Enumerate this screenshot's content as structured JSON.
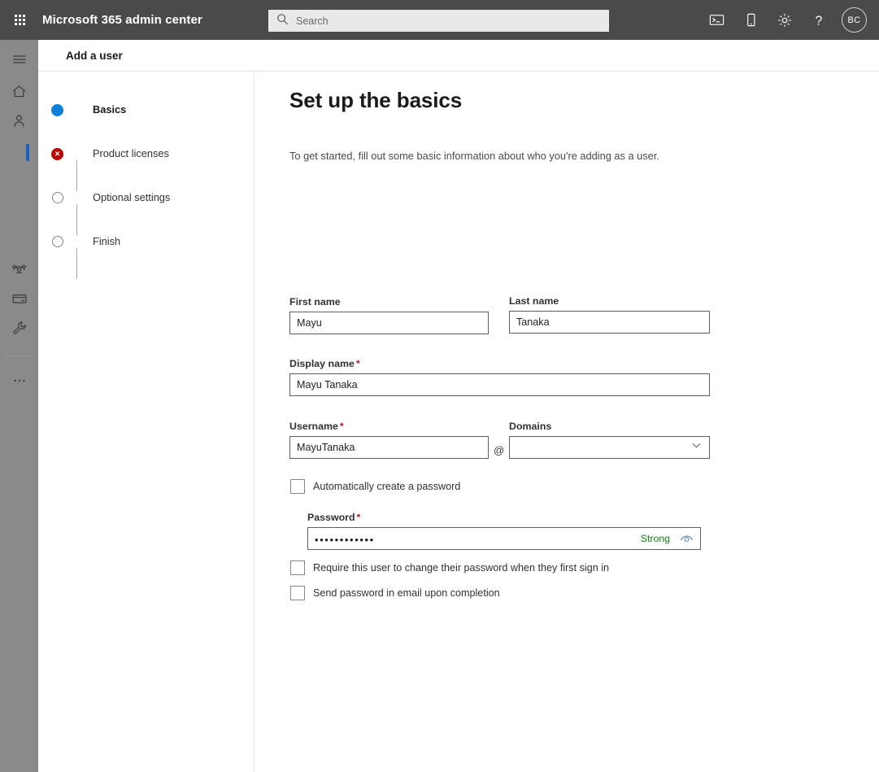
{
  "suitebar": {
    "waffle_label": "App launcher",
    "title": "Microsoft 365 admin center",
    "search_placeholder": "Search",
    "search_value": "",
    "icons": [
      {
        "name": "cloud-shell-icon",
        "label": "Cloud Shell"
      },
      {
        "name": "mobile-device-icon",
        "label": "Mobile"
      },
      {
        "name": "gear-icon",
        "label": "Settings"
      },
      {
        "name": "help-icon",
        "label": "Help"
      }
    ],
    "avatar_initials": "BC",
    "background_color": "#4a4a4a"
  },
  "rail": {
    "background_color": "#898989",
    "selected_indicator_color": "#1b5fbe",
    "items": [
      {
        "name": "hamburger-menu-icon",
        "label": "Show navigation",
        "selected": false
      },
      {
        "name": "home-icon",
        "label": "Home",
        "selected": false
      },
      {
        "name": "users-person-icon",
        "label": "Users",
        "selected": true
      },
      {
        "name": "teams-groups-icon",
        "label": "Teams & groups",
        "selected": false
      },
      {
        "name": "billing-card-icon",
        "label": "Billing",
        "selected": false
      },
      {
        "name": "support-wrench-icon",
        "label": "Setup",
        "selected": false
      },
      {
        "name": "show-all-ellipsis-icon",
        "label": "Show all",
        "selected": false
      }
    ]
  },
  "page": {
    "header_title": "Add a user",
    "heading": "Set up the basics",
    "lede": "To get started, fill out some basic information about who you're adding as a user."
  },
  "wizard": {
    "steps": [
      {
        "label": "Basics",
        "state": "current",
        "icon": "filled-circle-icon",
        "color": "#0f80d7"
      },
      {
        "label": "Product licenses",
        "state": "error",
        "icon": "error-circle-icon",
        "color": "#c00000",
        "glyph": "✕"
      },
      {
        "label": "Optional settings",
        "state": "pending",
        "icon": "empty-circle-icon",
        "color": "#8a8886"
      },
      {
        "label": "Finish",
        "state": "pending",
        "icon": "empty-circle-icon",
        "color": "#8a8886"
      }
    ]
  },
  "form": {
    "first_name": {
      "label": "First name",
      "value": "Mayu",
      "required": false,
      "placeholder": ""
    },
    "last_name": {
      "label": "Last name",
      "value": "Tanaka",
      "required": false,
      "placeholder": ""
    },
    "display_name": {
      "label": "Display name",
      "value": "Mayu Tanaka",
      "required": true,
      "required_mark": "*",
      "placeholder": ""
    },
    "username": {
      "label": "Username",
      "value": "MayuTanaka",
      "required": true,
      "required_mark": "*",
      "placeholder": ""
    },
    "at_separator": "@",
    "domains": {
      "label": "Domains",
      "value": "",
      "selected_option": "",
      "chevron": "chevron-down-icon"
    },
    "auto_password_checkbox": {
      "label": "Automatically create a password",
      "checked": false
    },
    "password": {
      "label": "Password",
      "required": true,
      "required_mark": "*",
      "masked_value": "••••••••••••",
      "strength_label": "Strong",
      "strength_color": "#107c10",
      "reveal_icon": "eye-reveal-icon"
    },
    "require_change_checkbox": {
      "label": "Require this user to change their password when they first sign in",
      "checked": false
    },
    "send_email_checkbox": {
      "label": "Send password in email upon completion",
      "checked": false
    }
  }
}
